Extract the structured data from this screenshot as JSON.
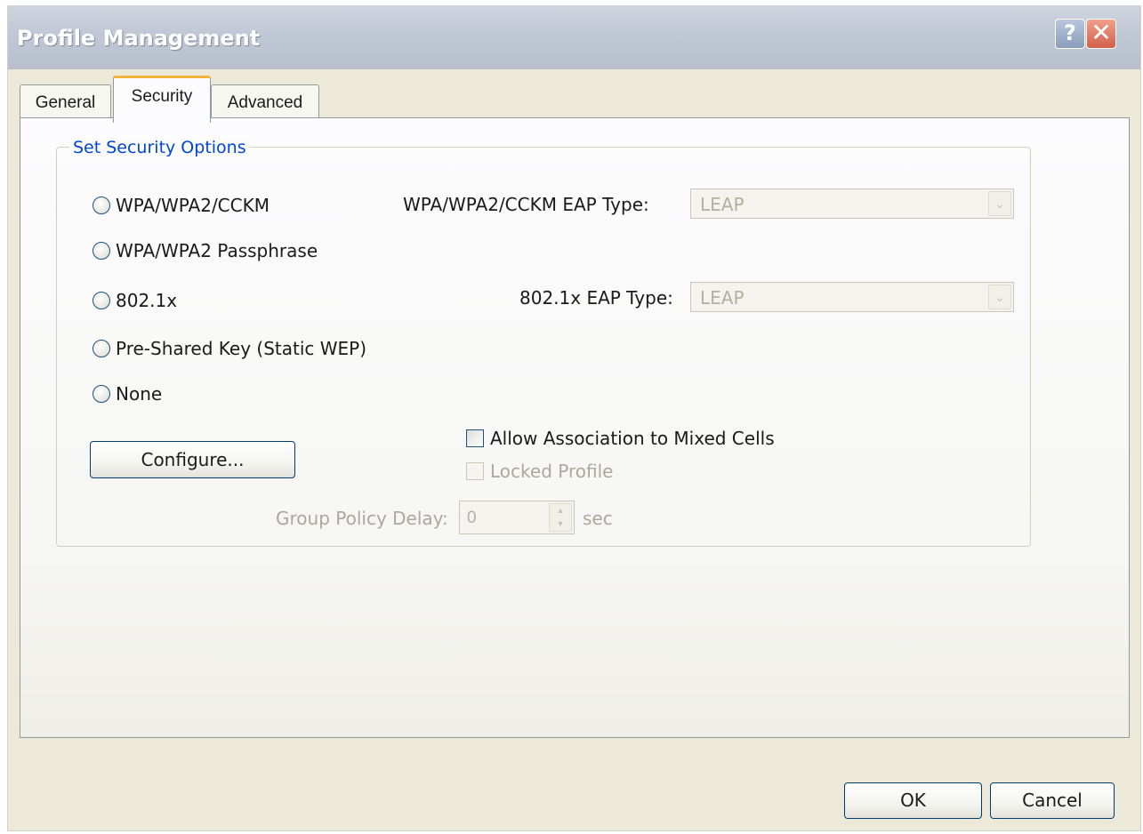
{
  "window": {
    "title": "Profile Management",
    "help_glyph": "?",
    "close_glyph": "✕"
  },
  "tabs": [
    {
      "label": "General",
      "active": false
    },
    {
      "label": "Security",
      "active": true
    },
    {
      "label": "Advanced",
      "active": false
    }
  ],
  "security": {
    "group_title": "Set Security Options",
    "radio_options": [
      {
        "label": "WPA/WPA2/CCKM",
        "selected": false
      },
      {
        "label": "WPA/WPA2 Passphrase",
        "selected": false
      },
      {
        "label": "802.1x",
        "selected": false
      },
      {
        "label": "Pre-Shared Key (Static WEP)",
        "selected": false
      },
      {
        "label": "None",
        "selected": false
      }
    ],
    "wpa_eap": {
      "label": "WPA/WPA2/CCKM EAP Type:",
      "value": "LEAP",
      "enabled": false
    },
    "eap_8021x": {
      "label": "802.1x EAP Type:",
      "value": "LEAP",
      "enabled": false
    },
    "configure_button": "Configure...",
    "allow_mixed_cells": {
      "label": "Allow Association to Mixed Cells",
      "checked": false,
      "enabled": true
    },
    "locked_profile": {
      "label": "Locked Profile",
      "checked": false,
      "enabled": false
    },
    "group_policy_delay": {
      "label": "Group Policy Delay:",
      "value": "0",
      "unit": "sec",
      "enabled": false
    }
  },
  "footer": {
    "ok_label": "OK",
    "cancel_label": "Cancel"
  },
  "colors": {
    "accent_tab": "#f3b33d",
    "group_title": "#0046d5",
    "button_border": "#003c74"
  }
}
